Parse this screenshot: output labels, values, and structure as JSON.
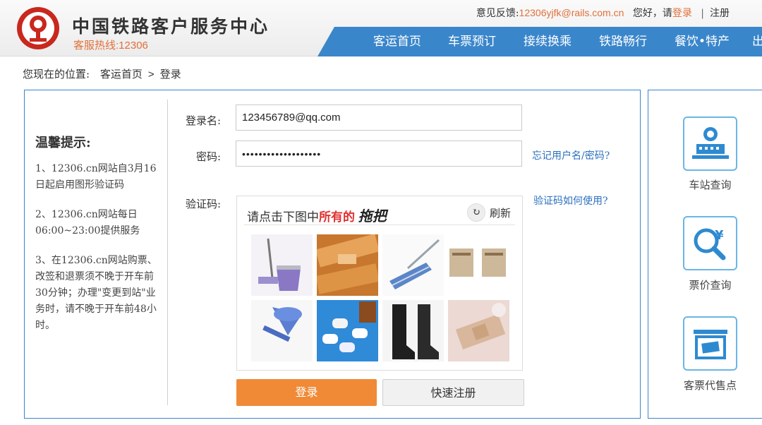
{
  "header": {
    "title": "中国铁路客户服务中心",
    "hotline": "客服热线:12306",
    "feedback_label": "意见反馈:",
    "feedback_email": "12306yjfk@rails.com.cn",
    "greeting": "您好，请",
    "login_link": "登录",
    "separator": "|",
    "register_link": "注册",
    "nav": [
      "客运首页",
      "车票预订",
      "接续换乘",
      "铁路畅行",
      "餐饮•特产",
      "出"
    ]
  },
  "breadcrumb": {
    "prefix": "您现在的位置:",
    "home": "客运首页",
    "arrow": ">",
    "current": "登录"
  },
  "tips": {
    "title": "温馨提示:",
    "items": [
      "1、12306.cn网站自3月16日起启用图形验证码",
      "2、12306.cn网站每日06:00~23:00提供服务",
      "3、在12306.cn网站购票、改签和退票须不晚于开车前30分钟；办理\"变更到站\"业务时，请不晚于开车前48小时。"
    ]
  },
  "form": {
    "username_label": "登录名:",
    "username_value": "123456789@qq.com",
    "password_label": "密码:",
    "password_value": "•••••••••••••••••••",
    "forgot_link": "忘记用户名/密码?",
    "captcha_label": "验证码:",
    "captcha_help_link": "验证码如何使用?",
    "captcha_prompt_pre": "请点击下图中",
    "captcha_prompt_em": "所有的",
    "captcha_prompt_word": "拖把",
    "refresh_label": "刷新",
    "login_button": "登录",
    "quick_register_button": "快速注册"
  },
  "side": {
    "items": [
      {
        "label": "车站查询",
        "icon": "station-icon"
      },
      {
        "label": "票价查询",
        "icon": "fare-search-icon"
      },
      {
        "label": "客票代售点",
        "icon": "ticket-agency-icon"
      }
    ]
  },
  "colors": {
    "brand_blue": "#3a86cb",
    "accent_orange": "#f08a36",
    "logo_red": "#c8281e",
    "link_blue": "#2a6fbf"
  }
}
